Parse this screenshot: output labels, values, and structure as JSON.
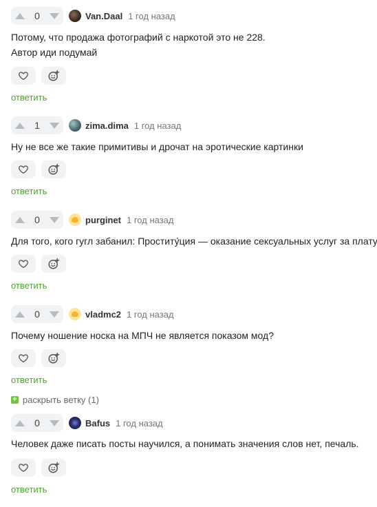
{
  "comments": [
    {
      "score": "0",
      "username": "Van.Daal",
      "time": "1 год назад",
      "avatar": "dark-portrait",
      "lines": [
        "Потому, что продажа фотографий с наркотой это не 228.",
        "Автор иди подумай"
      ],
      "reply_label": "ответить"
    },
    {
      "score": "1",
      "username": "zima.dima",
      "time": "1 год назад",
      "avatar": "planet",
      "lines": [
        "Ну не все же такие примитивы и дрочат на эротические картинки"
      ],
      "reply_label": "ответить"
    },
    {
      "score": "0",
      "username": "purginet",
      "time": "1 год назад",
      "avatar": "default-yellow",
      "lines": [
        "Для того, кого гугл забанил: Проститу́ция — оказание сексуальных услуг за плату."
      ],
      "reply_label": "ответить"
    },
    {
      "score": "0",
      "username": "vladmc2",
      "time": "1 год назад",
      "avatar": "default-yellow",
      "lines": [
        "Почему ношение носка на МПЧ не является показом мод?"
      ],
      "reply_label": "ответить"
    },
    {
      "score": "0",
      "username": "Bafus",
      "time": "1 год назад",
      "avatar": "blue-galaxy",
      "lines": [
        "Человек даже писать посты научился, а понимать значения слов нет, печаль."
      ],
      "reply_label": "ответить"
    }
  ],
  "expand_branch": {
    "label": "раскрыть ветку (1)"
  },
  "icons": {
    "upvote": "triangle-up-icon",
    "downvote": "triangle-down-icon",
    "like": "heart-icon",
    "reaction": "smiley-plus-icon",
    "expand": "plus-square-icon"
  },
  "colors": {
    "reply_link": "#4ca32c",
    "expand_icon": "#75c24a",
    "button_bg": "#f1f2f4"
  }
}
